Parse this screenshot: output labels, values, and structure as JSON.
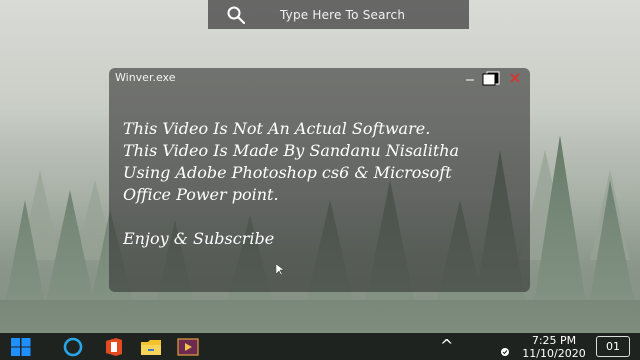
{
  "search": {
    "placeholder": "Type Here To Search",
    "icon": "search-icon"
  },
  "window": {
    "title": "Winver.exe",
    "controls": [
      "minimize-icon",
      "maximize-icon",
      "close-icon"
    ],
    "lines": [
      "This Video Is Not An Actual Software.",
      "This Video Is Made By Sandanu Nisalitha",
      "Using Adobe Photoshop cs6 & Microsoft",
      "Office Power point."
    ],
    "footer": "Enjoy & Subscribe"
  },
  "taskbar": {
    "apps": [
      "windows-start-icon",
      "cortana-icon",
      "office-icon",
      "file-explorer-icon",
      "video-player-icon"
    ],
    "tray_up": "^",
    "time": "7:25 PM",
    "date": "11/10/2020",
    "notification_count": "01"
  },
  "colors": {
    "close": "#e0322a",
    "office": "#e34a1f",
    "folder": "#f4c22b",
    "start": "#1e90ff",
    "cortana": "#2aa6e8"
  }
}
